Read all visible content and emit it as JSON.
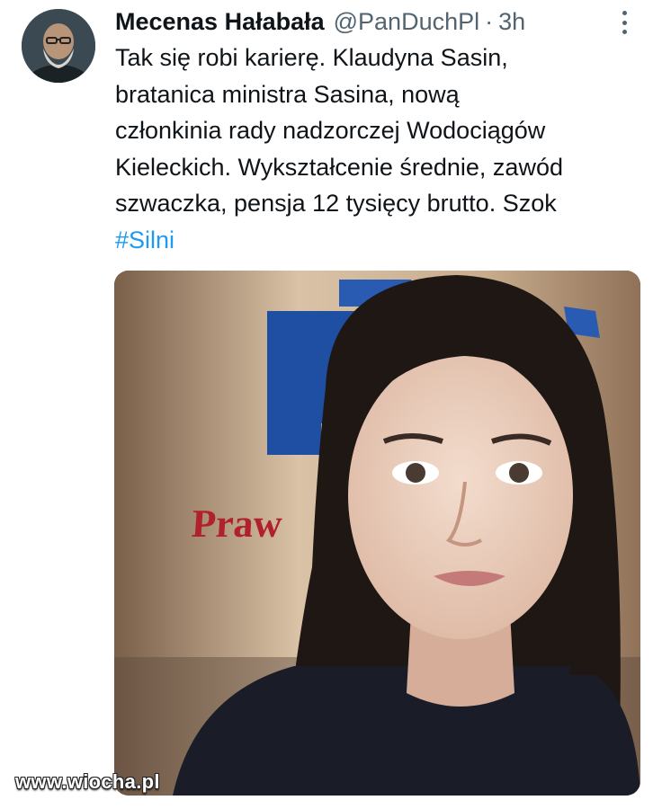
{
  "tweet": {
    "display_name": "Mecenas Hałabała",
    "handle": "@PanDuchPl",
    "separator": "·",
    "time": "3h",
    "text_lines": [
      "Tak się robi karierę. Klaudyna Sasin,",
      "bratanica ministra Sasina, nową",
      "członkinia rady nadzorczej Wodociągów",
      "Kieleckich. Wykształcenie średnie, zawód",
      "szwaczka, pensja 12 tysięcy brutto. Szok"
    ],
    "hashtag": "#Silni"
  },
  "media": {
    "backdrop_text": "Praw"
  },
  "watermark": "www.wiocha.pl",
  "colors": {
    "text": "#0f1419",
    "secondary": "#536471",
    "link": "#1d9bf0"
  },
  "icons": {
    "more": "more-vertical-icon"
  }
}
